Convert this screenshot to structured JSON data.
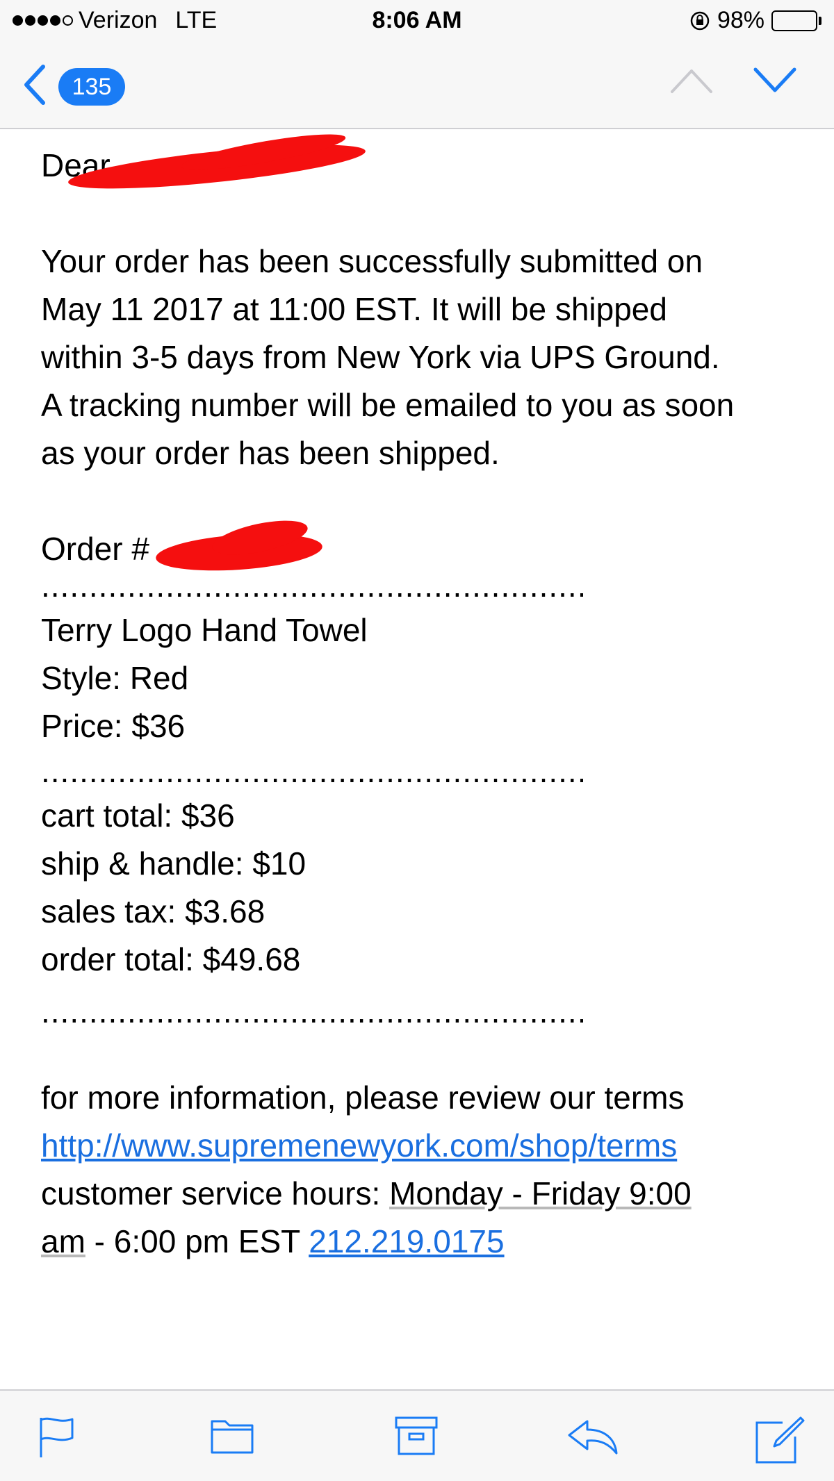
{
  "status_bar": {
    "carrier": "Verizon",
    "network": "LTE",
    "time": "8:06 AM",
    "battery_percent": "98%",
    "battery_level": 0.98,
    "signal_bars_filled": 4,
    "signal_bars_total": 5
  },
  "nav": {
    "back_count": "135"
  },
  "email": {
    "greeting": "Dear",
    "paragraph_lines": [
      "Your order has been successfully submitted on",
      "May 11 2017 at 11:00 EST. It will be shipped",
      "within 3-5 days from New York via UPS Ground.",
      "A tracking number will be emailed to you as soon",
      "as your order has been shipped."
    ],
    "order_label": "Order #",
    "separator": ".............................................................................",
    "item_name": "Terry Logo Hand Towel",
    "item_style": "Style: Red",
    "item_price": "Price: $36",
    "cart_total": "cart total: $36",
    "ship_handle": "ship & handle: $10",
    "sales_tax": "sales tax: $3.68",
    "order_total": "order total: $49.68",
    "info_text": "for more information, please review our terms",
    "terms_link": "http://www.supremenewyork.com/shop/terms",
    "hours_label": "customer service hours: ",
    "hours_link_part1": "Monday - Friday 9:00",
    "hours_link_part2": "am",
    "hours_rest": " - 6:00 pm EST ",
    "phone_link": "212.219.0175"
  },
  "toolbar": {
    "icons": [
      "flag-icon",
      "folder-icon",
      "archive-icon",
      "reply-icon",
      "compose-icon"
    ]
  },
  "colors": {
    "accent": "#1a7cf5",
    "link": "#1a6fe0",
    "redaction": "#f50f0f",
    "bar_background": "#f7f7f7"
  }
}
